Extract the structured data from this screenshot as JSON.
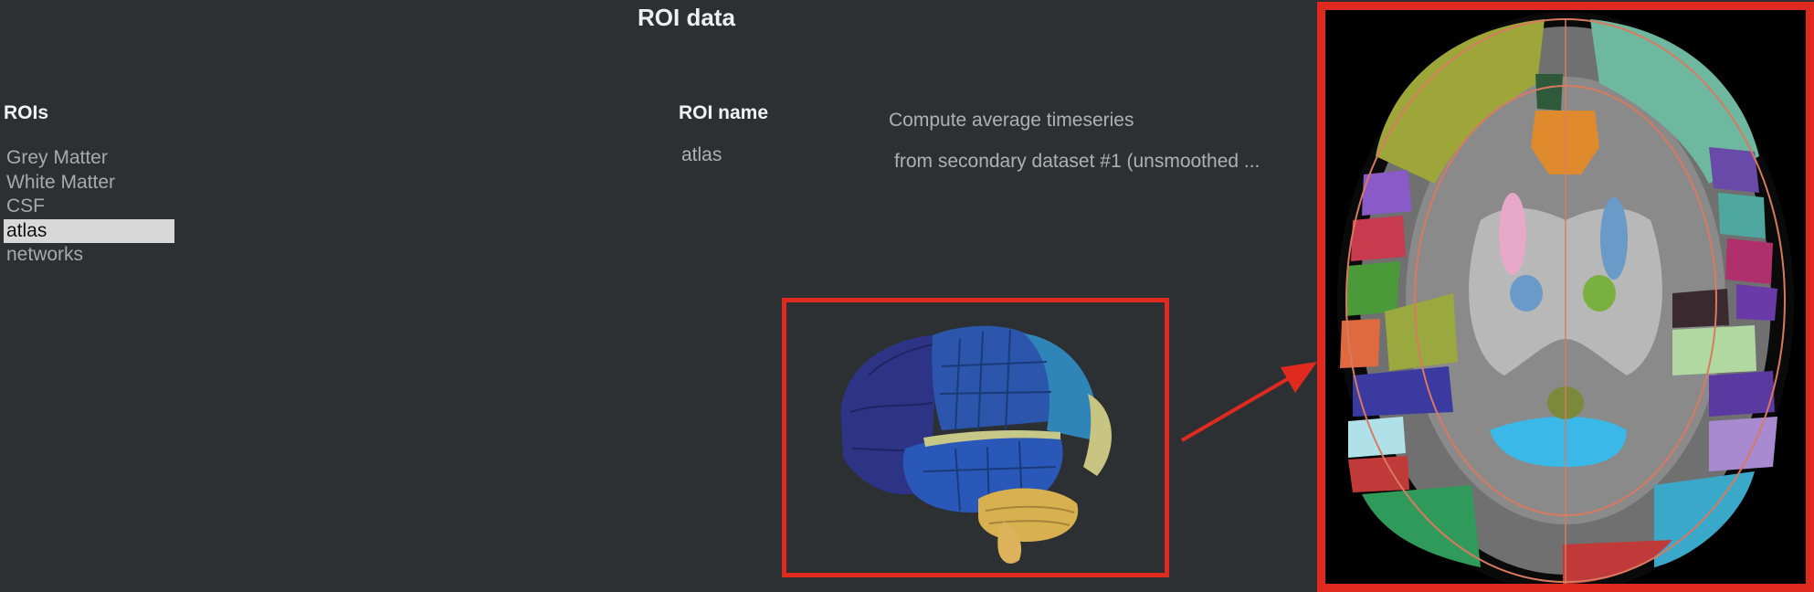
{
  "header": {
    "title": "ROI data"
  },
  "rois": {
    "label": "ROIs",
    "items": [
      {
        "label": "Grey Matter",
        "selected": false
      },
      {
        "label": "White Matter",
        "selected": false
      },
      {
        "label": "CSF",
        "selected": false
      },
      {
        "label": "atlas",
        "selected": true
      },
      {
        "label": "networks",
        "selected": false
      }
    ]
  },
  "roi_name": {
    "label": "ROI name",
    "value": "atlas"
  },
  "compute": {
    "label": "Compute average timeseries",
    "source_value": "from secondary dataset #1 (unsmoothed ..."
  },
  "views": {
    "render_3d": "3d-brain-atlas-render",
    "axial_slice": "axial-atlas-overlay-slice",
    "highlight_color": "#e02a20"
  },
  "colors": {
    "background": "#2d3033",
    "selection": "#d8d8d8"
  }
}
